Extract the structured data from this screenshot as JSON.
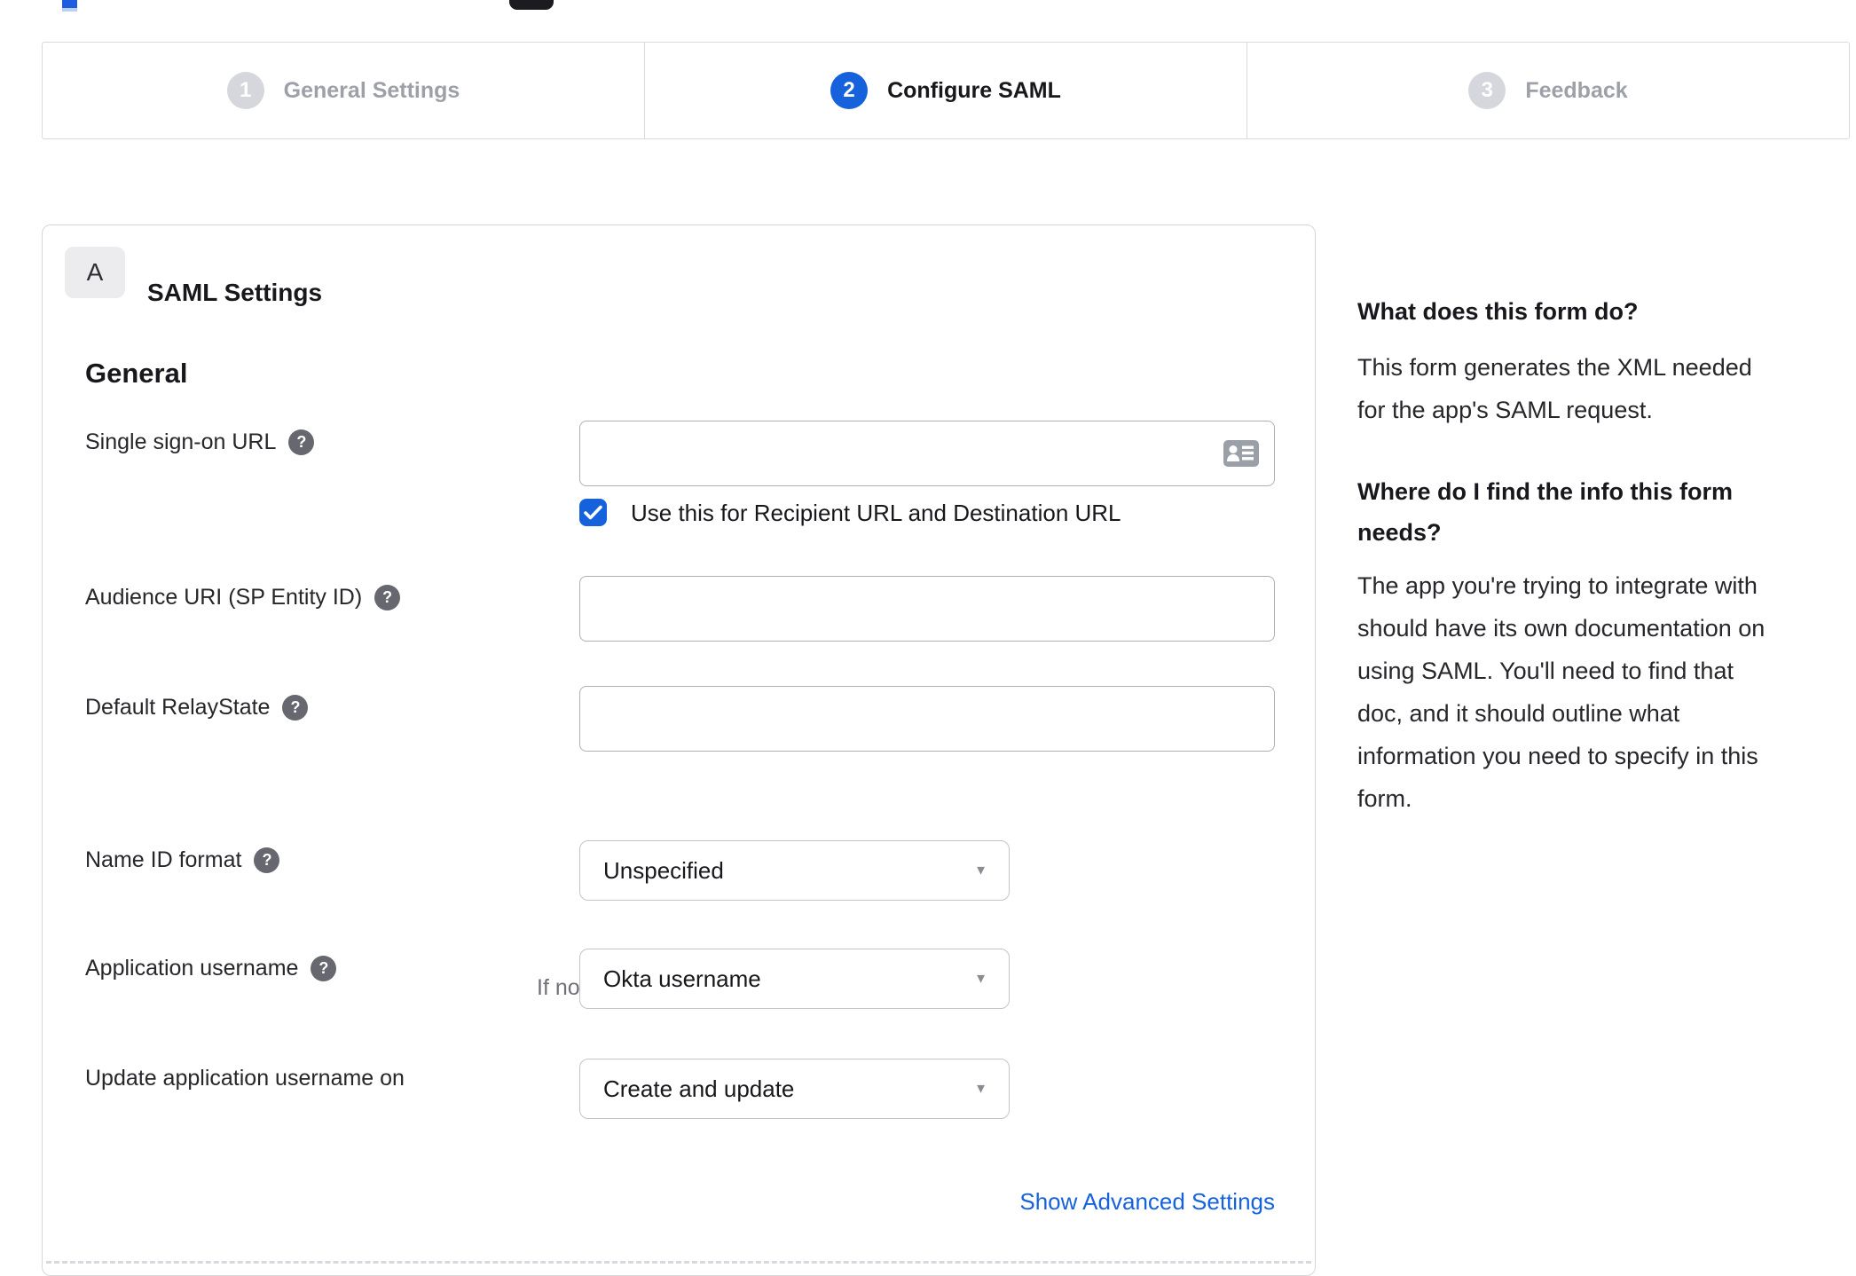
{
  "stepper": {
    "steps": [
      {
        "number": "1",
        "label": "General Settings",
        "state": "inactive"
      },
      {
        "number": "2",
        "label": "Configure SAML",
        "state": "active"
      },
      {
        "number": "3",
        "label": "Feedback",
        "state": "inactive"
      }
    ]
  },
  "panel": {
    "badge": "A",
    "title": "SAML Settings",
    "section_heading": "General",
    "fields": {
      "sso": {
        "label": "Single sign-on URL",
        "value": "",
        "checkbox_label": "Use this for Recipient URL and Destination URL",
        "checkbox_checked": true
      },
      "audience": {
        "label": "Audience URI (SP Entity ID)",
        "value": ""
      },
      "relay": {
        "label": "Default RelayState",
        "value": "",
        "helper": "If no value is set, a blank RelayState is sent"
      },
      "name_id": {
        "label": "Name ID format",
        "value": "Unspecified"
      },
      "app_username": {
        "label": "Application username",
        "value": "Okta username"
      },
      "update_username": {
        "label": "Update application username on",
        "value": "Create and update"
      }
    },
    "advanced_link": "Show Advanced Settings"
  },
  "sidebar": {
    "q1": "What does this form do?",
    "a1": "This form generates the XML needed\nfor the app's SAML request.",
    "q2": "Where do I find the info this form\nneeds?",
    "a2": "The app you're trying to integrate with\nshould have its own documentation on\nusing SAML. You'll need to find that\ndoc, and it should outline what\ninformation you need to specify in this\nform."
  },
  "icons": {
    "help": "?",
    "caret": "▼"
  },
  "colors": {
    "accent": "#1662dd",
    "link": "#1662dd",
    "inactive_step": "#d6d7dc"
  }
}
